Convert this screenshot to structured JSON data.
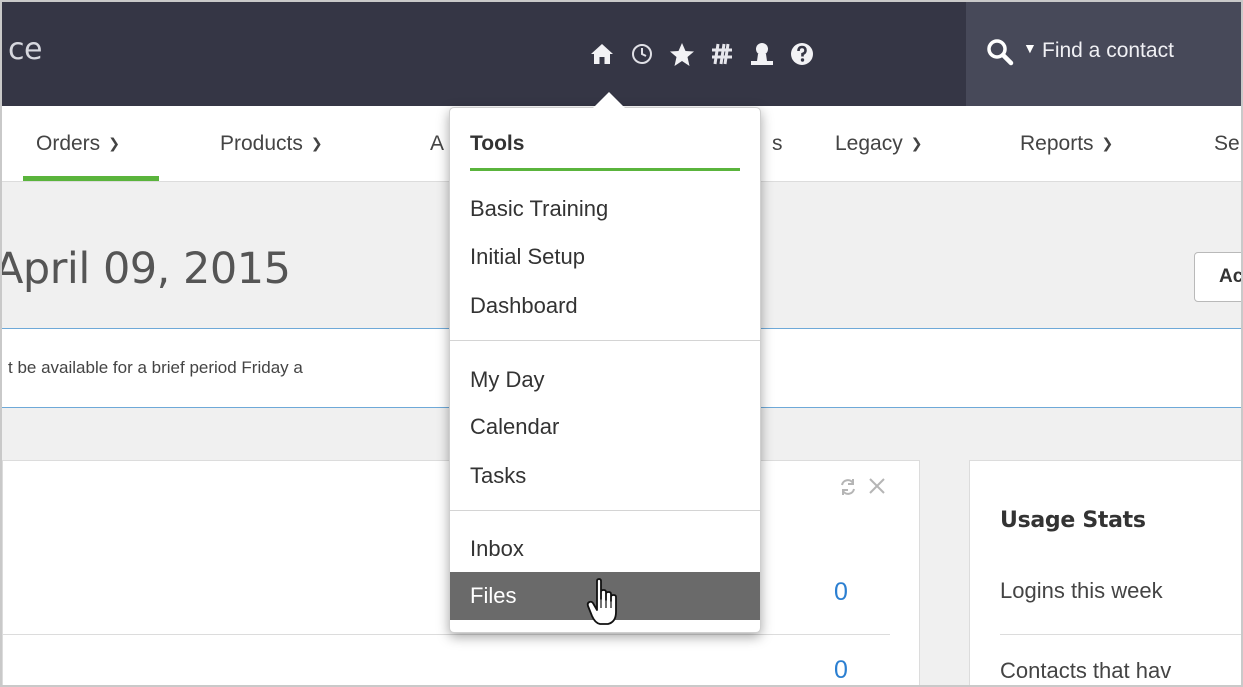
{
  "app": {
    "title_fragment": "ce"
  },
  "top_icons": [
    "home-icon",
    "clock-icon",
    "star-icon",
    "hashtag-icon",
    "user-icon",
    "help-icon"
  ],
  "search": {
    "placeholder": "Find a contact"
  },
  "nav": {
    "items": [
      {
        "label": "Orders"
      },
      {
        "label": "Products"
      },
      {
        "label": "A"
      },
      {
        "label": "s"
      },
      {
        "label": "Legacy"
      },
      {
        "label": "Reports"
      },
      {
        "label": "Se"
      }
    ]
  },
  "header": {
    "date": "April 09, 2015",
    "action_label": "Ac"
  },
  "notice": {
    "text": "t be available for a brief period Friday a"
  },
  "panel": {
    "values": [
      "0",
      "0"
    ]
  },
  "usage": {
    "title": "Usage Stats",
    "rows": [
      "Logins this week",
      "Contacts that hav"
    ]
  },
  "dropdown": {
    "heading": "Tools",
    "groups": [
      [
        "Basic Training",
        "Initial Setup",
        "Dashboard"
      ],
      [
        "My Day",
        "Calendar",
        "Tasks"
      ],
      [
        "Inbox",
        "Files"
      ]
    ],
    "active": "Files"
  },
  "colors": {
    "topbar": "#353645",
    "accent_green": "#5ab43c",
    "link_blue": "#2b7fd1",
    "active_item": "#6a6a6a"
  }
}
